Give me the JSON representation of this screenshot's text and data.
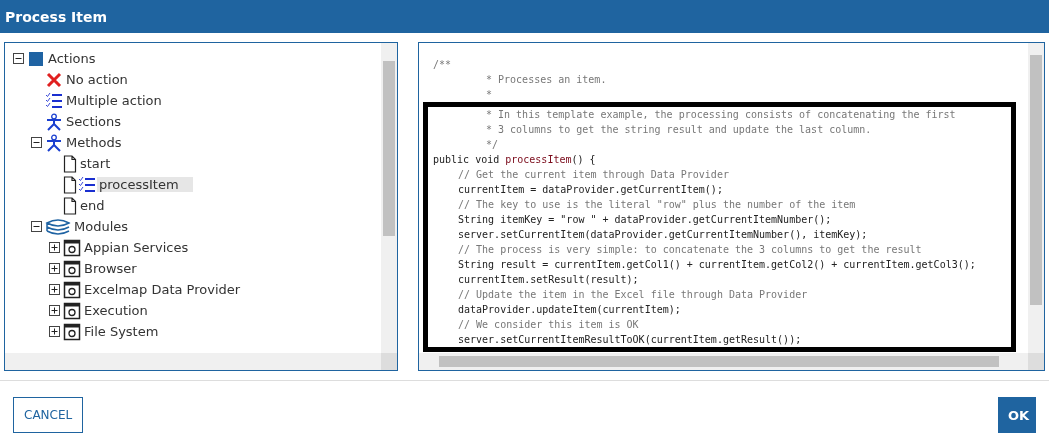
{
  "window": {
    "title": "Process Item"
  },
  "tree": [
    {
      "label": "Actions",
      "kind": "root",
      "expanded": true,
      "children": [
        {
          "label": "No action",
          "kind": "no-action",
          "selected": false
        },
        {
          "label": "Multiple action",
          "kind": "multiple",
          "selected": false
        },
        {
          "label": "Sections",
          "kind": "figure",
          "selected": false
        },
        {
          "label": "Methods",
          "kind": "figure",
          "expanded": true,
          "selected": false,
          "children": [
            {
              "label": "start",
              "kind": "document",
              "selected": false
            },
            {
              "label": "processItem",
              "kind": "document-multiple",
              "selected": true
            },
            {
              "label": "end",
              "kind": "document",
              "selected": false
            }
          ]
        },
        {
          "label": "Modules",
          "kind": "stack",
          "expanded": true,
          "selected": false,
          "children": [
            {
              "label": "Appian Services",
              "kind": "module",
              "expanded": false,
              "selected": false
            },
            {
              "label": "Browser",
              "kind": "module",
              "expanded": false,
              "selected": false
            },
            {
              "label": "Excelmap Data Provider",
              "kind": "module",
              "expanded": false,
              "selected": false
            },
            {
              "label": "Execution",
              "kind": "module",
              "expanded": false,
              "selected": false
            },
            {
              "label": "File System",
              "kind": "module",
              "expanded": false,
              "selected": false
            }
          ]
        }
      ]
    }
  ],
  "code": {
    "lines": [
      {
        "kind": "doc-start",
        "text": "/**"
      },
      {
        "kind": "doc",
        "text": "* Processes an item."
      },
      {
        "kind": "doc",
        "text": "*"
      }
    ],
    "highlight": [
      {
        "kind": "doc",
        "text": "* In this template example, the processing consists of concatenating the first"
      },
      {
        "kind": "doc",
        "text": "* 3 columns to get the string result and update the last column."
      },
      {
        "kind": "doc",
        "text": "*/"
      },
      {
        "kind": "signature",
        "prefix": "public void ",
        "name": "processItem",
        "suffix": "() {"
      },
      {
        "kind": "comment",
        "text": "// Get the current item through Data Provider"
      },
      {
        "kind": "code",
        "text": "currentItem = dataProvider.getCurrentItem();"
      },
      {
        "kind": "comment",
        "text": "// The key to use is the literal \"row\" plus the number of the item"
      },
      {
        "kind": "code",
        "text": "String itemKey = \"row \" + dataProvider.getCurrentItemNumber();"
      },
      {
        "kind": "code",
        "text": "server.setCurrentItem(dataProvider.getCurrentItemNumber(), itemKey);"
      },
      {
        "kind": "comment",
        "text": "// The process is very simple: to concatenate the 3 columns to get the result"
      },
      {
        "kind": "code",
        "text": "String result = currentItem.getCol1() + currentItem.getCol2() + currentItem.getCol3();"
      },
      {
        "kind": "code",
        "text": "currentItem.setResult(result);"
      },
      {
        "kind": "comment",
        "text": "// Update the item in the Excel file through Data Provider"
      },
      {
        "kind": "code",
        "text": "dataProvider.updateItem(currentItem);"
      },
      {
        "kind": "comment",
        "text": "// We consider this item is OK"
      },
      {
        "kind": "code",
        "text": "server.setCurrentItemResultToOK(currentItem.getResult());"
      }
    ]
  },
  "buttons": [
    {
      "label": "CANCEL",
      "kind": "secondary"
    },
    {
      "label": "OK",
      "kind": "primary"
    }
  ]
}
